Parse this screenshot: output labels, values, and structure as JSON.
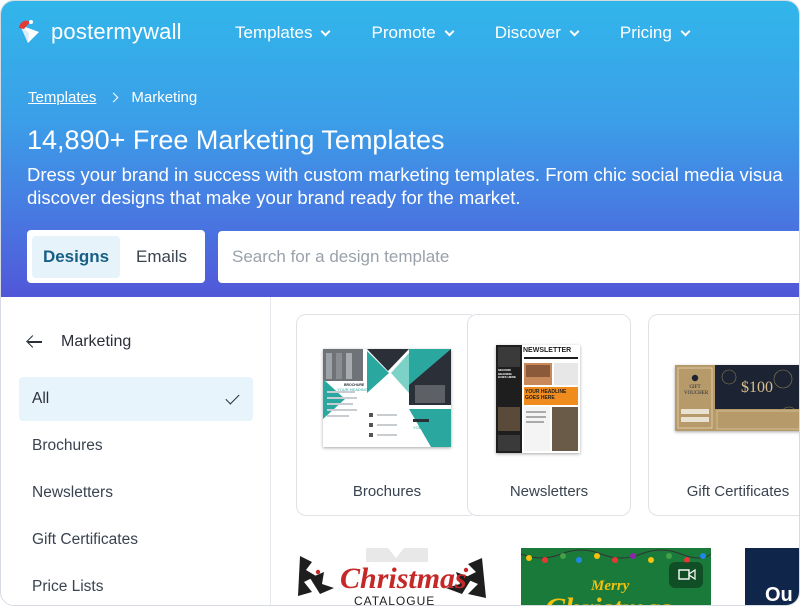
{
  "brand": {
    "name": "postermywall"
  },
  "nav": [
    {
      "label": "Templates"
    },
    {
      "label": "Promote"
    },
    {
      "label": "Discover"
    },
    {
      "label": "Pricing"
    }
  ],
  "breadcrumb": {
    "root": "Templates",
    "current": "Marketing"
  },
  "hero": {
    "title": "14,890+ Free Marketing Templates",
    "desc_line1": "Dress your brand in success with custom marketing templates. From chic social media visua",
    "desc_line2": "discover designs that make your brand ready for the market."
  },
  "type_switch": {
    "designs": "Designs",
    "emails": "Emails"
  },
  "search": {
    "placeholder": "Search for a design template"
  },
  "sidebar": {
    "heading": "Marketing",
    "items": [
      {
        "label": "All",
        "active": true
      },
      {
        "label": "Brochures"
      },
      {
        "label": "Newsletters"
      },
      {
        "label": "Gift Certificates"
      },
      {
        "label": "Price Lists"
      }
    ]
  },
  "cards": [
    {
      "label": "Brochures",
      "thumb": {
        "heading": "YOUR HEADING",
        "sub": "BROCHURE",
        "company": "YOUR COMPANY"
      }
    },
    {
      "label": "Newsletters",
      "thumb": {
        "masthead": "NEWSLETTER",
        "headline": "YOUR HEADLINE GOES HERE",
        "second": "SECOND HEADING GOES HERE"
      }
    },
    {
      "label": "Gift Certificates",
      "thumb": {
        "voucher": "GIFT VOUCHER",
        "amount": "$100"
      }
    }
  ],
  "bottom_row": {
    "christmas_title": "Christmas",
    "christmas_sub": "CATALOGUE",
    "merry": "Merry",
    "merry_christmas": "Christmas",
    "partial": "Ou"
  },
  "colors": {
    "accent_teal": "#2aa8a0",
    "hero_top": "#31b6ea",
    "hero_bottom": "#5157d8",
    "active_bg": "#e8f4fc"
  }
}
